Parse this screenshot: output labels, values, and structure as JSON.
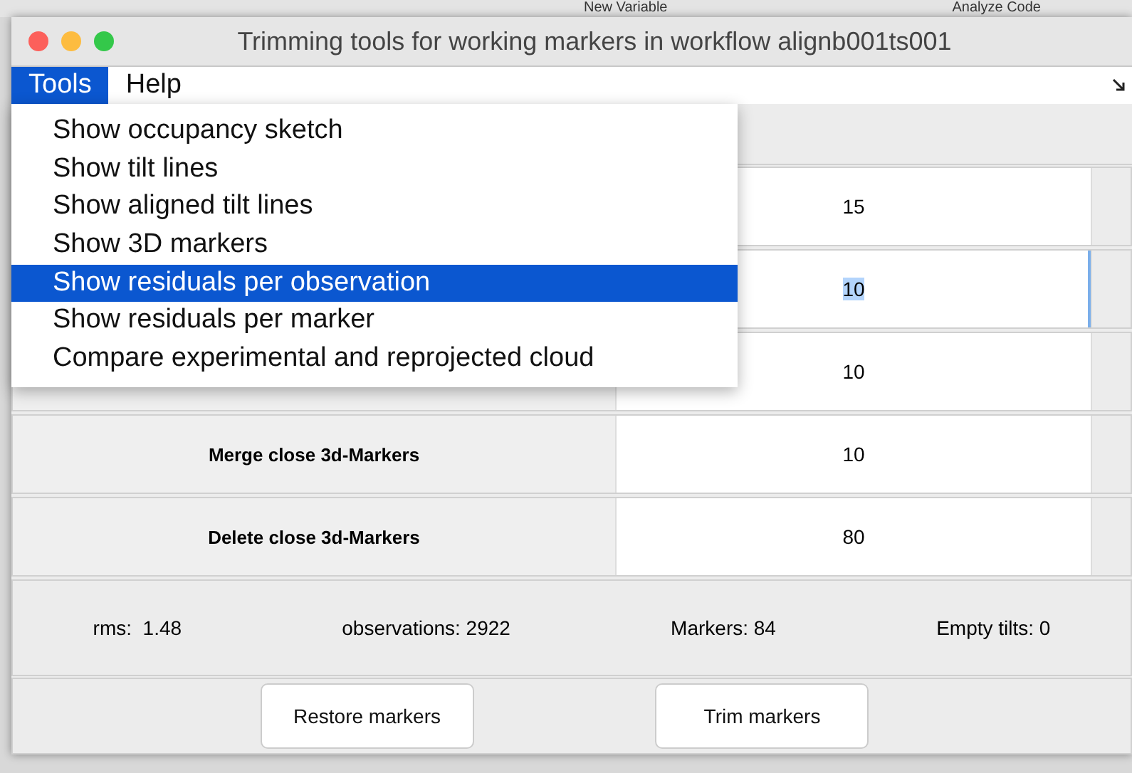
{
  "background_toolbar": {
    "items": [
      "New Variable",
      "Analyze Code"
    ]
  },
  "window": {
    "title": "Trimming tools for working markers in workflow alignb001ts001"
  },
  "menu_bar": [
    {
      "label": "Tools",
      "selected": true
    },
    {
      "label": "Help",
      "selected": false
    }
  ],
  "menu": {
    "items": [
      {
        "label": "Show occupancy sketch",
        "selected": false
      },
      {
        "label": "Show tilt lines",
        "selected": false
      },
      {
        "label": "Show aligned tilt lines",
        "selected": false
      },
      {
        "label": "Show 3D markers",
        "selected": false
      },
      {
        "label": "Show residuals per observation",
        "selected": true
      },
      {
        "label": "Show residuals per marker",
        "selected": false
      },
      {
        "label": "Compare experimental and reprojected cloud",
        "selected": false
      }
    ]
  },
  "parameters": [
    {
      "value": "15",
      "focused": false
    },
    {
      "value": "10",
      "focused": true
    },
    {
      "value": "10",
      "focused": false
    },
    {
      "label": "Merge close 3d-Markers",
      "value": "10",
      "focused": false
    },
    {
      "label": "Delete close 3d-Markers",
      "value": "80",
      "focused": false
    }
  ],
  "status": [
    "rms:  1.48",
    "observations: 2922",
    "Markers: 84",
    "Empty tilts: 0"
  ],
  "buttons": [
    "Restore markers",
    "Trim markers"
  ]
}
